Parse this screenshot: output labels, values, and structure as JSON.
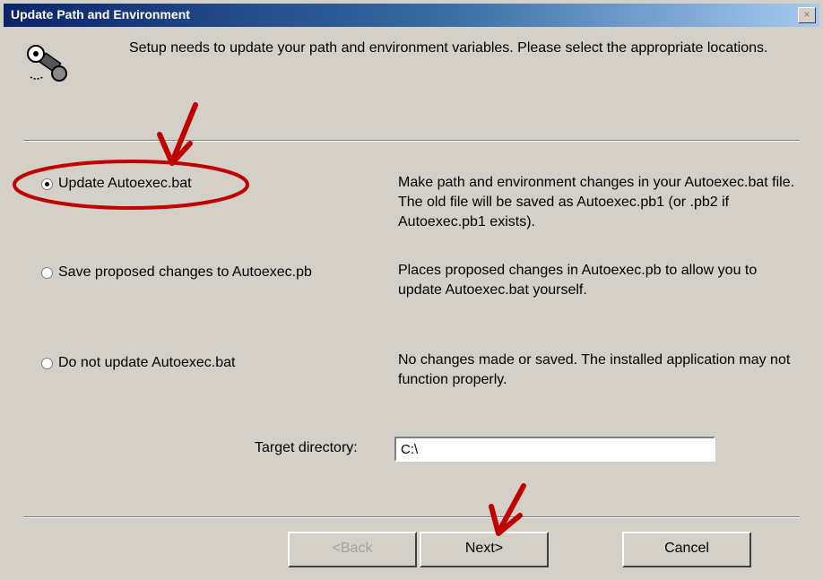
{
  "window": {
    "title": "Update Path and Environment",
    "close_glyph": "×"
  },
  "intro": {
    "text": "Setup needs to update your path and environment variables.  Please select the appropriate locations."
  },
  "options": [
    {
      "label": "Update Autoexec.bat",
      "checked": true,
      "description": "Make path and environment changes in your Autoexec.bat file.  The old file will be saved as Autoexec.pb1 (or .pb2 if Autoexec.pb1 exists)."
    },
    {
      "label": "Save proposed changes to Autoexec.pb",
      "checked": false,
      "description": "Places proposed changes in Autoexec.pb to allow you to update Autoexec.bat yourself."
    },
    {
      "label": "Do not update Autoexec.bat",
      "checked": false,
      "description": "No changes made or saved.  The installed application may not function properly."
    }
  ],
  "target": {
    "label": "Target directory:",
    "value": "C:\\"
  },
  "buttons": {
    "back": "<Back",
    "next": "Next>",
    "cancel": "Cancel"
  },
  "colors": {
    "face": "#d4d0c8",
    "title_start": "#0a246a",
    "annotation": "#c00000"
  }
}
